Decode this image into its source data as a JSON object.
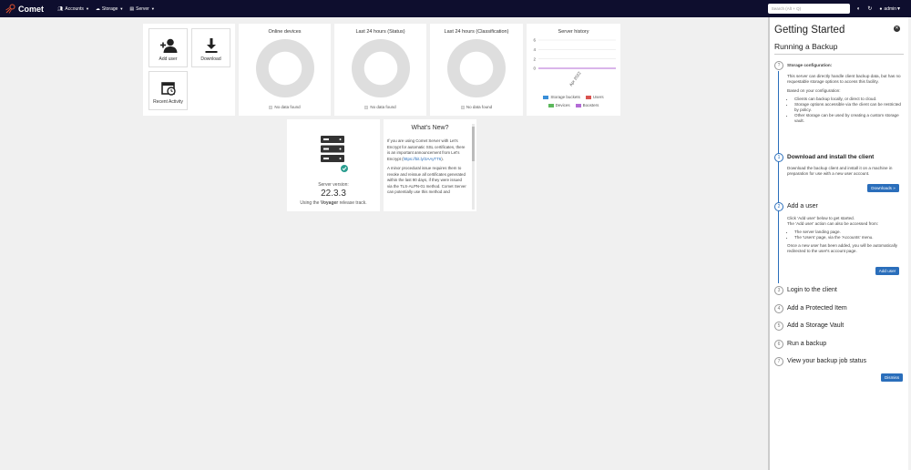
{
  "brand": {
    "name": "Comet"
  },
  "nav": {
    "accounts": "Accounts",
    "storage": "Storage",
    "server": "Server",
    "search_placeholder": "Search (Alt + Q)",
    "user": "admin"
  },
  "tiles": {
    "add_user": "Add user",
    "download": "Download",
    "recent_activity": "Recent Activity"
  },
  "charts": {
    "online_devices": {
      "title": "Online devices",
      "no_data": "No data found"
    },
    "last24_status": {
      "title": "Last 24 hours (Status)",
      "no_data": "No data found"
    },
    "last24_class": {
      "title": "Last 24 hours (Classification)",
      "no_data": "No data found"
    }
  },
  "chart_data": {
    "type": "line",
    "title": "Server history",
    "x": [
      "Apr 2022"
    ],
    "y_ticks": [
      0,
      2,
      4,
      6
    ],
    "ylim": [
      0,
      6
    ],
    "series": [
      {
        "name": "Storage buckets",
        "color": "#3a8fd8",
        "values": [
          0
        ]
      },
      {
        "name": "Users",
        "color": "#d9534f",
        "values": [
          0
        ]
      },
      {
        "name": "Devices",
        "color": "#5cb85c",
        "values": [
          0
        ]
      },
      {
        "name": "Boosters",
        "color": "#b36bd6",
        "values": [
          0
        ]
      }
    ],
    "grid": true,
    "legend": "bottom"
  },
  "version": {
    "label": "Server version:",
    "number": "22.3.3",
    "track_prefix": "Using the",
    "track_name": "Voyager",
    "track_suffix": "release track."
  },
  "whats_new": {
    "title": "What's New?",
    "p1_before": "If you are using Comet Server with Let's Encrypt for automatic SSL certificates, there is an important announcement from Let's Encrypt (",
    "p1_link": "https://bit.ly/3AAyTT6",
    "p1_after": ").",
    "p2": "A minor procedural issue requires them to revoke and reissue all certificates generated within the last 90 days, if they were issued via the TLS-ALPN-01 method. Comet Server can potentially use this method and"
  },
  "getting_started": {
    "title": "Getting Started",
    "subtitle": "Running a Backup",
    "storage": {
      "marker": "?",
      "title": "Storage configuration:",
      "p1": "This server can directly handle client backup data, but has no requestable storage options to access this facility.",
      "p2": "Based on your configuration:",
      "bullets": [
        "Clients can backup locally, or direct to cloud.",
        "Storage options accessible via the client can be restricted by policy.",
        "Other storage can be used by creating a custom storage vault."
      ]
    },
    "steps": [
      {
        "num": "1",
        "title": "Download and install the client"
      },
      {
        "num": "2",
        "title": "Add a user"
      },
      {
        "num": "3",
        "title": "Login to the client"
      },
      {
        "num": "4",
        "title": "Add a Protected Item"
      },
      {
        "num": "5",
        "title": "Add a Storage Vault"
      },
      {
        "num": "6",
        "title": "Run a backup"
      },
      {
        "num": "7",
        "title": "View your backup job status"
      }
    ],
    "step1_text": "Download the backup client and install it on a machine in preparation for use with a new user account.",
    "downloads_button": "Downloads »",
    "step2_p1": "Click 'Add user' below to get started.",
    "step2_p2": "The 'Add user' action can also be accessed from:",
    "step2_bullets": [
      "The server landing page.",
      "The 'Users' page, via the 'Accounts' menu."
    ],
    "step2_p3": "Once a new user has been added, you will be automatically redirected to the user's account page.",
    "add_user_button": "Add user",
    "dismiss_button": "Dismiss"
  }
}
